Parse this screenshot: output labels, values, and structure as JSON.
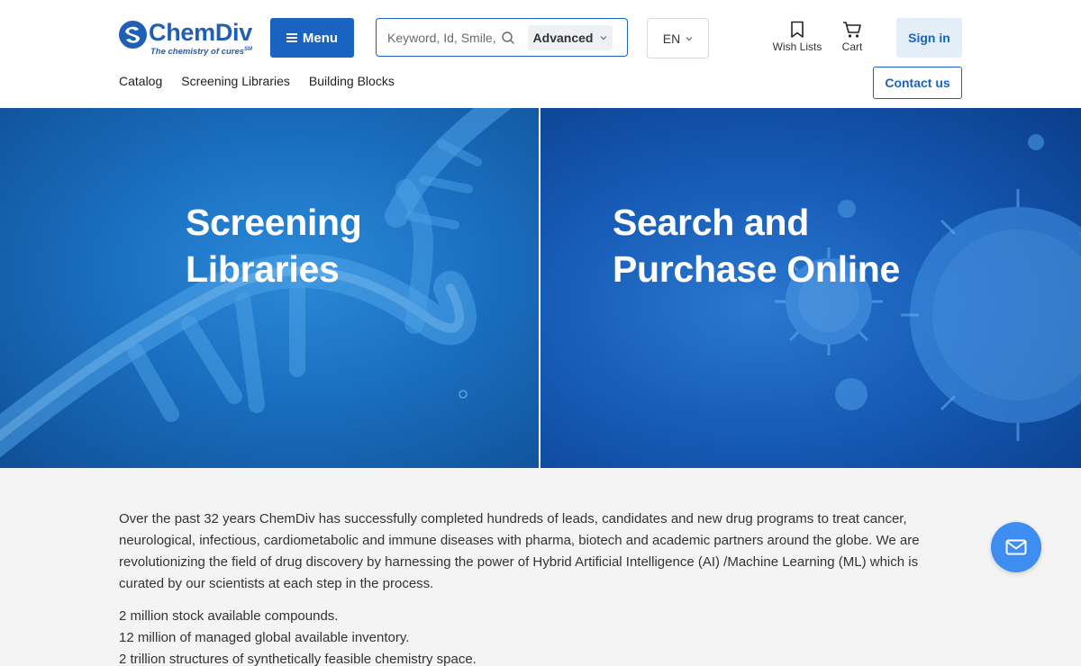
{
  "header": {
    "logo": {
      "name": "ChemDiv",
      "tagline": "The chemistry of cures",
      "tagline_mark": "SM"
    },
    "menu_label": "Menu",
    "search": {
      "placeholder": "Keyword, Id, Smile, CAS",
      "advanced_label": "Advanced"
    },
    "language": "EN",
    "wishlists_label": "Wish Lists",
    "cart_label": "Cart",
    "signin_label": "Sign in",
    "contact_label": "Contact us"
  },
  "nav": {
    "items": [
      {
        "label": "Catalog"
      },
      {
        "label": "Screening Libraries"
      },
      {
        "label": "Building Blocks"
      }
    ]
  },
  "hero": {
    "left": {
      "line1": "Screening",
      "line2": "Libraries"
    },
    "right": {
      "line1": "Search and",
      "line2": "Purchase Online"
    }
  },
  "content": {
    "intro": "Over the past 32 years ChemDiv has successfully completed hundreds of leads, candidates and new drug programs to treat cancer, neurological, infectious, cardiometabolic and immune diseases with pharma, biotech and academic partners around the globe. We are revolutionizing the field of drug discovery by harnessing the power of Hybrid Artificial Intelligence (AI) /Machine Learning (ML) which is curated by our scientists at each step in the process.",
    "stats": [
      "2 million stock available compounds.",
      "12 million of managed global available inventory.",
      "2 trillion structures of synthetically feasible chemistry space."
    ]
  },
  "icons": {
    "menu": "hamburger-icon",
    "search": "search-icon",
    "wishlist": "bookmark-icon",
    "cart": "cart-icon",
    "mail": "mail-icon"
  },
  "colors": {
    "brand": "#1f5fb5",
    "primary_button": "#1a63c0",
    "signin_bg": "#e4eef9",
    "fab": "#3d8ef0",
    "page_bg": "#f4f4f5"
  }
}
